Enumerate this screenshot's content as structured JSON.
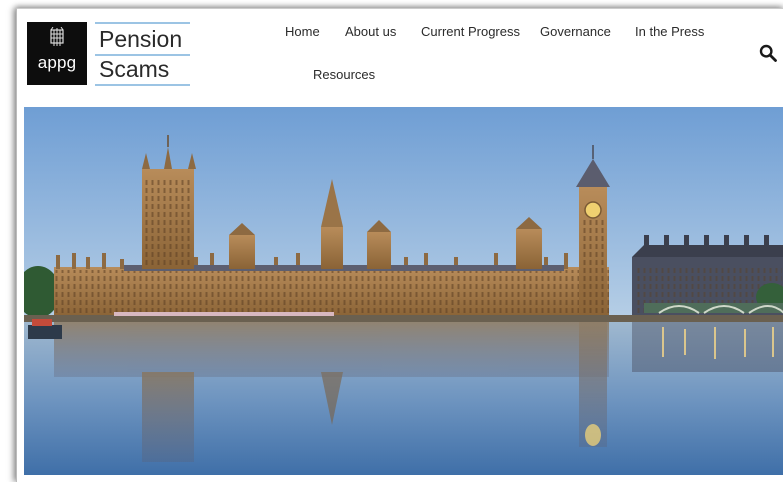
{
  "logo": {
    "badge_text": "appg",
    "line1": "Pension",
    "line2": "Scams"
  },
  "nav": {
    "items": [
      {
        "label": "Home"
      },
      {
        "label": "About us"
      },
      {
        "label": "Current Progress"
      },
      {
        "label": "Governance"
      },
      {
        "label": "In the Press"
      },
      {
        "label": "Resources"
      }
    ],
    "search_icon": "search-icon"
  },
  "hero": {
    "image": "houses-of-parliament-photo"
  },
  "colors": {
    "logo_rule": "#9cc4e4",
    "nav_text": "#2b2b2b",
    "sky_top": "#6f9ed4",
    "sky_bottom": "#b7cfe6",
    "stone": "#a27a4c"
  }
}
